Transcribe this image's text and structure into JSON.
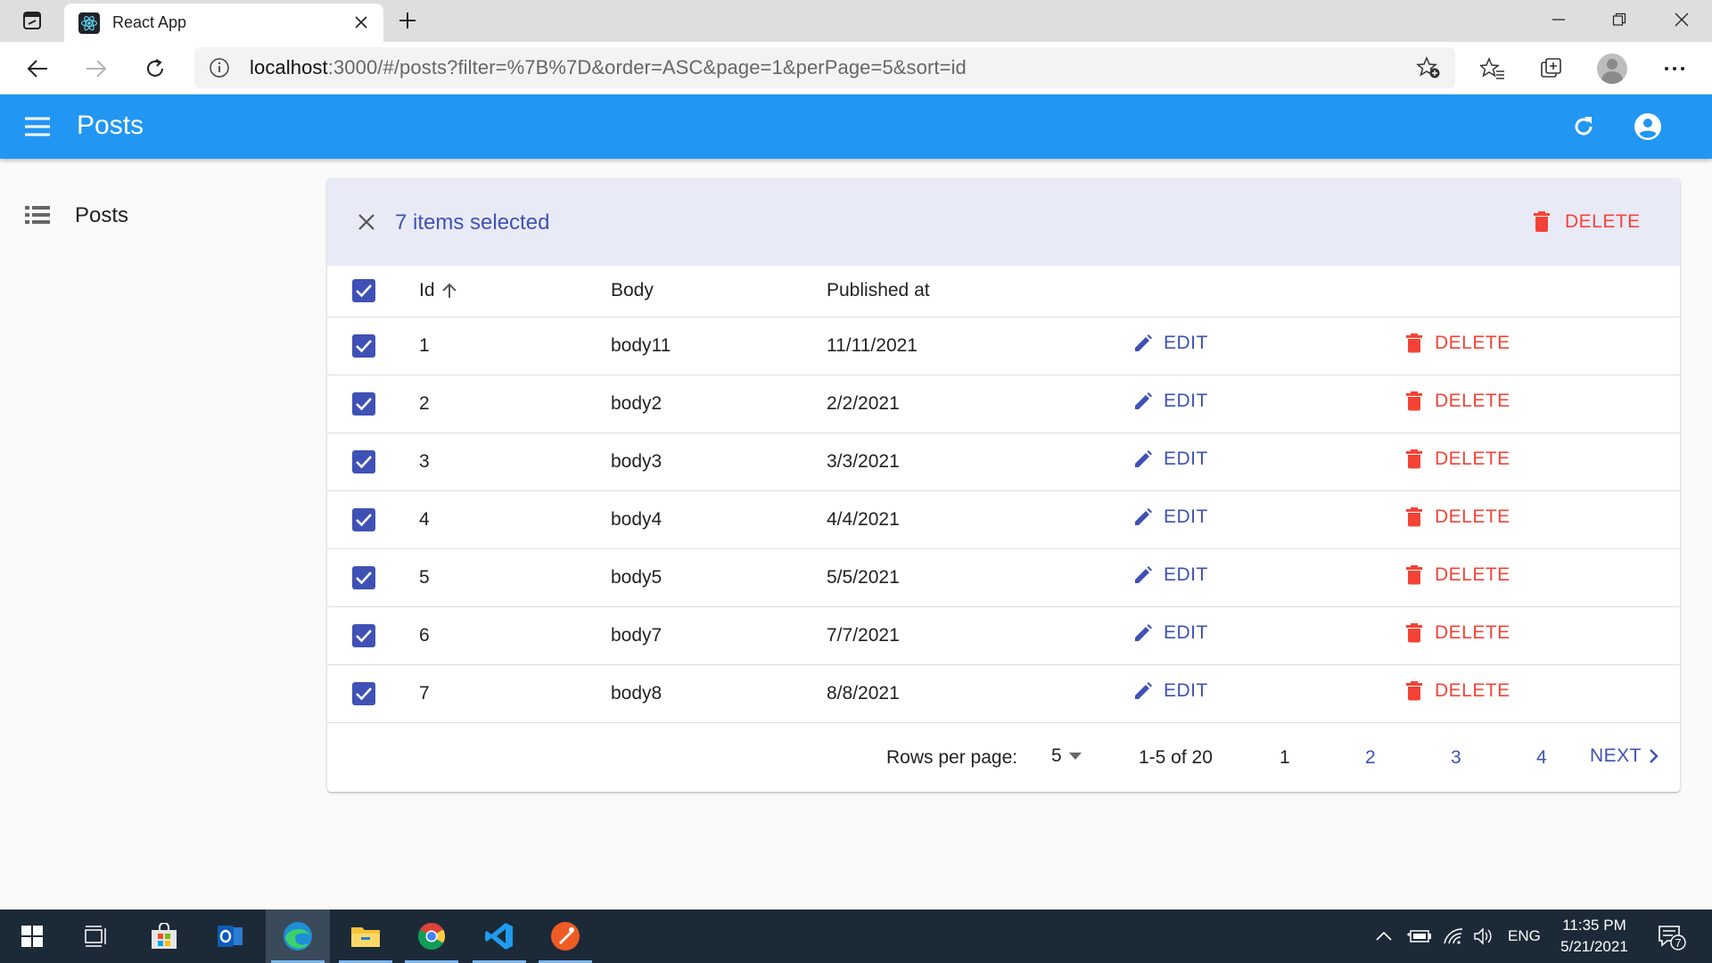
{
  "browser": {
    "tab_title": "React App",
    "url_host": "localhost",
    "url_rest": ":3000/#/posts?filter=%7B%7D&order=ASC&page=1&perPage=5&sort=id"
  },
  "app": {
    "title": "Posts",
    "primary_color": "#2196f3"
  },
  "sidebar": {
    "items": [
      {
        "label": "Posts",
        "icon": "list-icon"
      }
    ]
  },
  "bulk_actions": {
    "selected_text": "7 items selected",
    "delete_label": "DELETE"
  },
  "table": {
    "columns": {
      "id": "Id",
      "body": "Body",
      "published": "Published at"
    },
    "sort": {
      "field": "Id",
      "direction": "ASC"
    },
    "rows": [
      {
        "id": "1",
        "body": "body11",
        "published": "11/11/2021",
        "edit": "EDIT",
        "delete": "DELETE",
        "checked": true
      },
      {
        "id": "2",
        "body": "body2",
        "published": "2/2/2021",
        "edit": "EDIT",
        "delete": "DELETE",
        "checked": true
      },
      {
        "id": "3",
        "body": "body3",
        "published": "3/3/2021",
        "edit": "EDIT",
        "delete": "DELETE",
        "checked": true
      },
      {
        "id": "4",
        "body": "body4",
        "published": "4/4/2021",
        "edit": "EDIT",
        "delete": "DELETE",
        "checked": true
      },
      {
        "id": "5",
        "body": "body5",
        "published": "5/5/2021",
        "edit": "EDIT",
        "delete": "DELETE",
        "checked": true
      },
      {
        "id": "6",
        "body": "body7",
        "published": "7/7/2021",
        "edit": "EDIT",
        "delete": "DELETE",
        "checked": true
      },
      {
        "id": "7",
        "body": "body8",
        "published": "8/8/2021",
        "edit": "EDIT",
        "delete": "DELETE",
        "checked": true
      }
    ]
  },
  "pagination": {
    "rows_per_page_label": "Rows per page:",
    "rows_per_page_value": "5",
    "range": "1-5 of 20",
    "pages": [
      "1",
      "2",
      "3",
      "4"
    ],
    "current_page": "1",
    "next_label": "NEXT"
  },
  "taskbar": {
    "language": "ENG",
    "time": "11:35 PM",
    "date": "5/21/2021",
    "notification_count": "7"
  }
}
